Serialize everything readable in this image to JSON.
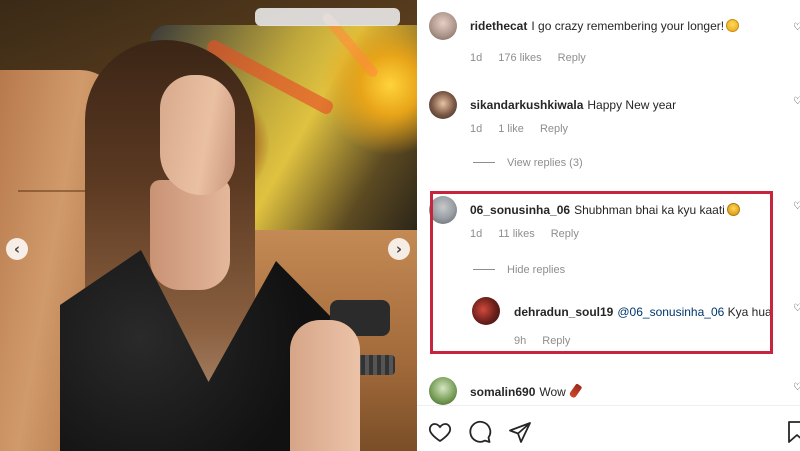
{
  "post": {
    "nav_prev": "‹",
    "nav_next": "›"
  },
  "comments": [
    {
      "username": "ridethecat",
      "text": "I go crazy remembering your longer!",
      "emoji": "cool-face-emoji",
      "time": "1d",
      "likes": "176 likes",
      "reply": "Reply"
    },
    {
      "username": "sikandarkushkiwala",
      "text": "Happy New year",
      "time": "1d",
      "likes": "1 like",
      "reply": "Reply",
      "view_replies": "View replies (3)"
    },
    {
      "username": "06_sonusinha_06",
      "text": "Shubhman bhai ka kyu kaati",
      "emoji": "sad-face-emoji",
      "time": "1d",
      "likes": "11 likes",
      "reply": "Reply",
      "hide_replies": "Hide replies",
      "replies": [
        {
          "username": "dehradun_soul19",
          "mention": "@06_sonusinha_06",
          "text": "Kya hua",
          "time": "9h",
          "reply": "Reply"
        }
      ]
    },
    {
      "username": "somalin690",
      "text": "Wow",
      "emoji": "bottle-emoji"
    }
  ],
  "actions": {
    "like": "heart-icon",
    "comment": "comment-icon",
    "share": "share-icon",
    "save": "bookmark-icon"
  },
  "colors": {
    "highlight_border": "#c7253e",
    "meta_text": "#8e8e8e",
    "mention": "#00376b"
  }
}
